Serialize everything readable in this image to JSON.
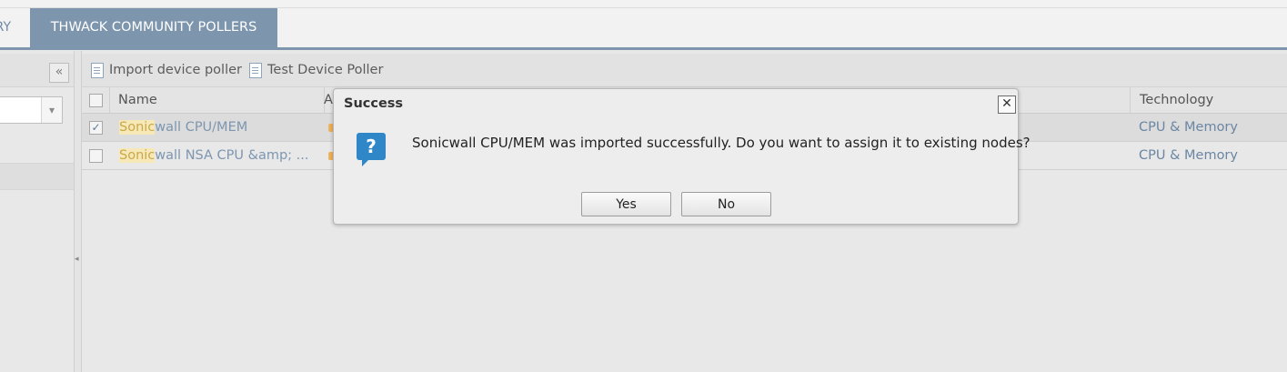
{
  "tabs": {
    "partial_label": "RY",
    "active_label": "THWACK COMMUNITY POLLERS"
  },
  "left_panel": {
    "collapse_glyph": "«",
    "select_arrow": "▾",
    "splitter_glyph": "◂"
  },
  "toolbar": {
    "import_label": "Import device poller",
    "test_label": "Test Device Poller"
  },
  "table": {
    "columns": {
      "name": "Name",
      "author": "A",
      "technology": "Technology"
    },
    "rows": [
      {
        "checked": "✓",
        "name_highlight": "Sonic",
        "name_rest": "wall CPU/MEM",
        "technology": "CPU & Memory"
      },
      {
        "checked": "",
        "name_highlight": "Sonic",
        "name_rest": "wall NSA CPU &amp; ...",
        "technology": "CPU & Memory"
      }
    ]
  },
  "dialog": {
    "title": "Success",
    "close_glyph": "✕",
    "icon_glyph": "?",
    "message": "Sonicwall CPU/MEM was imported successfully. Do you want to assign it to existing nodes?",
    "yes_label": "Yes",
    "no_label": "No"
  }
}
